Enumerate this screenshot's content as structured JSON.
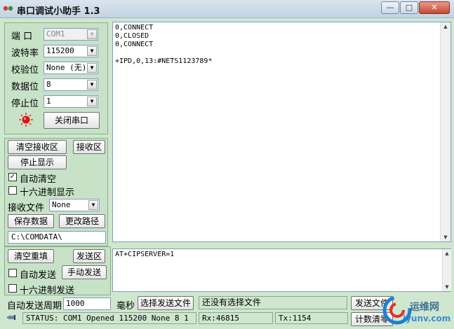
{
  "window": {
    "title": "串口调试小助手 1.3",
    "controls": {
      "min": "—",
      "max": "□",
      "close": "✕"
    }
  },
  "settings": {
    "port": {
      "label": "端 口",
      "value": "COM1"
    },
    "baud": {
      "label": "波特率",
      "value": "115200"
    },
    "parity": {
      "label": "校验位",
      "value": "None (无)"
    },
    "databits": {
      "label": "数据位",
      "value": "8"
    },
    "stopbits": {
      "label": "停止位",
      "value": "1"
    },
    "close_port": "关闭串口"
  },
  "receive": {
    "clear": "清空接收区",
    "area_label": "接收区",
    "stop_display": "停止显示",
    "auto_clear": "自动清空",
    "hex_display": "十六进制显示",
    "file_label": "接收文件",
    "file_value": "None",
    "save_data": "保存数据",
    "change_path": "更改路径",
    "path": "C:\\COMDATA\\",
    "text": "0,CONNECT\n0,CLOSED\n0,CONNECT\n\n+IPD,0,13:#NETS1123789*"
  },
  "send": {
    "clear": "清空重填",
    "area_label": "发送区",
    "auto_send": "自动发送",
    "manual_send": "手动发送",
    "hex_send": "十六进制发送",
    "period_label": "自动发送周期",
    "period_value": "1000",
    "ms": "毫秒",
    "choose_file": "选择发送文件",
    "no_file": "还没有选择文件",
    "send_file": "发送文件",
    "count_clear": "计数清零",
    "text": "AT+CIPSERVER=1"
  },
  "status": {
    "line": "STATUS: COM1 Opened 115200 None  8 1",
    "rx": "Rx:46815",
    "tx": "Tx:1154"
  },
  "watermark": {
    "brand": "运维网",
    "url": "iyunv.com"
  }
}
